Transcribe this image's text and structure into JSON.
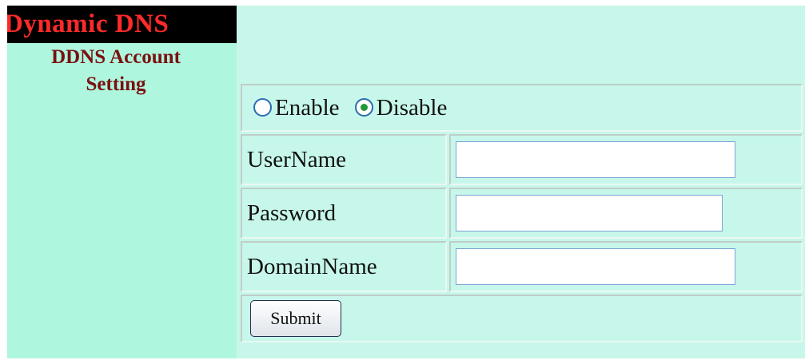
{
  "sidebar": {
    "title": "Dynamic DNS",
    "link": "DDNS Account Setting"
  },
  "form": {
    "radio": {
      "options": [
        {
          "label": "Enable",
          "checked": false
        },
        {
          "label": "Disable",
          "checked": true
        }
      ]
    },
    "fields": [
      {
        "label": "UserName",
        "value": "",
        "placeholder": ""
      },
      {
        "label": "Password",
        "value": "",
        "placeholder": ""
      },
      {
        "label": "DomainName",
        "value": "",
        "placeholder": ""
      }
    ],
    "submit_label": "Submit"
  },
  "colors": {
    "sidebar_bg": "#aef6de",
    "main_bg": "#c7f7ea",
    "title_bg": "#000000",
    "title_text": "#ff2a2a",
    "link_text": "#7a1010",
    "radio_selected": "#1f9a3a"
  }
}
